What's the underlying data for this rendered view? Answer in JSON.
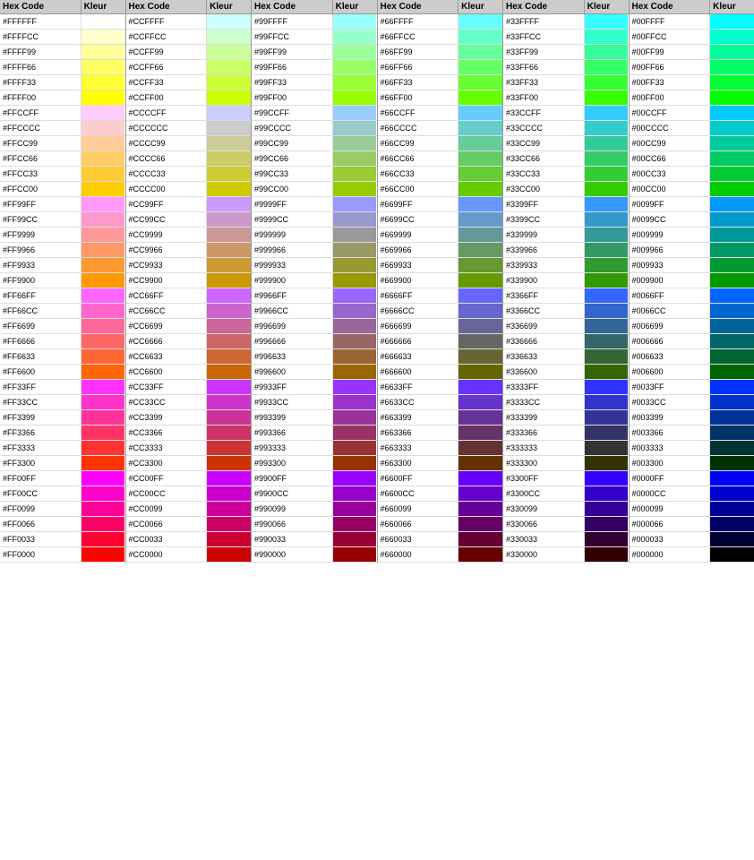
{
  "columns": [
    {
      "header": {
        "hex": "Hex Code",
        "kleur": "Kleur"
      },
      "colors": [
        {
          "hex": "#FFFFFF",
          "color": "#FFFFFF"
        },
        {
          "hex": "#FFFFCC",
          "color": "#FFFFCC"
        },
        {
          "hex": "#FFFF99",
          "color": "#FFFF99"
        },
        {
          "hex": "#FFFF66",
          "color": "#FFFF66"
        },
        {
          "hex": "#FFFF33",
          "color": "#FFFF33"
        },
        {
          "hex": "#FFFF00",
          "color": "#FFFF00"
        },
        {
          "hex": "#FFCCFF",
          "color": "#FFCCFF"
        },
        {
          "hex": "#FFCCCC",
          "color": "#FFCCCC"
        },
        {
          "hex": "#FFCC99",
          "color": "#FFCC99"
        },
        {
          "hex": "#FFCC66",
          "color": "#FFCC66"
        },
        {
          "hex": "#FFCC33",
          "color": "#FFCC33"
        },
        {
          "hex": "#FFCC00",
          "color": "#FFCC00"
        },
        {
          "hex": "#FF99FF",
          "color": "#FF99FF"
        },
        {
          "hex": "#FF99CC",
          "color": "#FF99CC"
        },
        {
          "hex": "#FF9999",
          "color": "#FF9999"
        },
        {
          "hex": "#FF9966",
          "color": "#FF9966"
        },
        {
          "hex": "#FF9933",
          "color": "#FF9933"
        },
        {
          "hex": "#FF9900",
          "color": "#FF9900"
        },
        {
          "hex": "#FF66FF",
          "color": "#FF66FF"
        },
        {
          "hex": "#FF66CC",
          "color": "#FF66CC"
        },
        {
          "hex": "#FF6699",
          "color": "#FF6699"
        },
        {
          "hex": "#FF6666",
          "color": "#FF6666"
        },
        {
          "hex": "#FF6633",
          "color": "#FF6633"
        },
        {
          "hex": "#FF6600",
          "color": "#FF6600"
        },
        {
          "hex": "#FF33FF",
          "color": "#FF33FF"
        },
        {
          "hex": "#FF33CC",
          "color": "#FF33CC"
        },
        {
          "hex": "#FF3399",
          "color": "#FF3399"
        },
        {
          "hex": "#FF3366",
          "color": "#FF3366"
        },
        {
          "hex": "#FF3333",
          "color": "#FF3333"
        },
        {
          "hex": "#FF3300",
          "color": "#FF3300"
        },
        {
          "hex": "#FF00FF",
          "color": "#FF00FF"
        },
        {
          "hex": "#FF00CC",
          "color": "#FF00CC"
        },
        {
          "hex": "#FF0099",
          "color": "#FF0099"
        },
        {
          "hex": "#FF0066",
          "color": "#FF0066"
        },
        {
          "hex": "#FF0033",
          "color": "#FF0033"
        },
        {
          "hex": "#FF0000",
          "color": "#FF0000"
        }
      ]
    },
    {
      "header": {
        "hex": "Hex Code",
        "kleur": "Kleur"
      },
      "colors": [
        {
          "hex": "#CCFFFF",
          "color": "#CCFFFF"
        },
        {
          "hex": "#CCFFCC",
          "color": "#CCFFCC"
        },
        {
          "hex": "#CCFF99",
          "color": "#CCFF99"
        },
        {
          "hex": "#CCFF66",
          "color": "#CCFF66"
        },
        {
          "hex": "#CCFF33",
          "color": "#CCFF33"
        },
        {
          "hex": "#CCFF00",
          "color": "#CCFF00"
        },
        {
          "hex": "#CCCCFF",
          "color": "#CCCCFF"
        },
        {
          "hex": "#CCCCCC",
          "color": "#CCCCCC"
        },
        {
          "hex": "#CCCC99",
          "color": "#CCCC99"
        },
        {
          "hex": "#CCCC66",
          "color": "#CCCC66"
        },
        {
          "hex": "#CCCC33",
          "color": "#CCCC33"
        },
        {
          "hex": "#CCCC00",
          "color": "#CCCC00"
        },
        {
          "hex": "#CC99FF",
          "color": "#CC99FF"
        },
        {
          "hex": "#CC99CC",
          "color": "#CC99CC"
        },
        {
          "hex": "#CC9999",
          "color": "#CC9999"
        },
        {
          "hex": "#CC9966",
          "color": "#CC9966"
        },
        {
          "hex": "#CC9933",
          "color": "#CC9933"
        },
        {
          "hex": "#CC9900",
          "color": "#CC9900"
        },
        {
          "hex": "#CC66FF",
          "color": "#CC66FF"
        },
        {
          "hex": "#CC66CC",
          "color": "#CC66CC"
        },
        {
          "hex": "#CC6699",
          "color": "#CC6699"
        },
        {
          "hex": "#CC6666",
          "color": "#CC6666"
        },
        {
          "hex": "#CC6633",
          "color": "#CC6633"
        },
        {
          "hex": "#CC6600",
          "color": "#CC6600"
        },
        {
          "hex": "#CC33FF",
          "color": "#CC33FF"
        },
        {
          "hex": "#CC33CC",
          "color": "#CC33CC"
        },
        {
          "hex": "#CC3399",
          "color": "#CC3399"
        },
        {
          "hex": "#CC3366",
          "color": "#CC3366"
        },
        {
          "hex": "#CC3333",
          "color": "#CC3333"
        },
        {
          "hex": "#CC3300",
          "color": "#CC3300"
        },
        {
          "hex": "#CC00FF",
          "color": "#CC00FF"
        },
        {
          "hex": "#CC00CC",
          "color": "#CC00CC"
        },
        {
          "hex": "#CC0099",
          "color": "#CC0099"
        },
        {
          "hex": "#CC0066",
          "color": "#CC0066"
        },
        {
          "hex": "#CC0033",
          "color": "#CC0033"
        },
        {
          "hex": "#CC0000",
          "color": "#CC0000"
        }
      ]
    },
    {
      "header": {
        "hex": "Hex Code",
        "kleur": "Kleur"
      },
      "colors": [
        {
          "hex": "#99FFFF",
          "color": "#99FFFF"
        },
        {
          "hex": "#99FFCC",
          "color": "#99FFCC"
        },
        {
          "hex": "#99FF99",
          "color": "#99FF99"
        },
        {
          "hex": "#99FF66",
          "color": "#99FF66"
        },
        {
          "hex": "#99FF33",
          "color": "#99FF33"
        },
        {
          "hex": "#99FF00",
          "color": "#99FF00"
        },
        {
          "hex": "#99CCFF",
          "color": "#99CCFF"
        },
        {
          "hex": "#99CCCC",
          "color": "#99CCCC"
        },
        {
          "hex": "#99CC99",
          "color": "#99CC99"
        },
        {
          "hex": "#99CC66",
          "color": "#99CC66"
        },
        {
          "hex": "#99CC33",
          "color": "#99CC33"
        },
        {
          "hex": "#99CC00",
          "color": "#99CC00"
        },
        {
          "hex": "#9999FF",
          "color": "#9999FF"
        },
        {
          "hex": "#9999CC",
          "color": "#9999CC"
        },
        {
          "hex": "#999999",
          "color": "#999999"
        },
        {
          "hex": "#999966",
          "color": "#999966"
        },
        {
          "hex": "#999933",
          "color": "#999933"
        },
        {
          "hex": "#999900",
          "color": "#999900"
        },
        {
          "hex": "#9966FF",
          "color": "#9966FF"
        },
        {
          "hex": "#9966CC",
          "color": "#9966CC"
        },
        {
          "hex": "#996699",
          "color": "#996699"
        },
        {
          "hex": "#996666",
          "color": "#996666"
        },
        {
          "hex": "#996633",
          "color": "#996633"
        },
        {
          "hex": "#996600",
          "color": "#996600"
        },
        {
          "hex": "#9933FF",
          "color": "#9933FF"
        },
        {
          "hex": "#9933CC",
          "color": "#9933CC"
        },
        {
          "hex": "#993399",
          "color": "#993399"
        },
        {
          "hex": "#993366",
          "color": "#993366"
        },
        {
          "hex": "#993333",
          "color": "#993333"
        },
        {
          "hex": "#993300",
          "color": "#993300"
        },
        {
          "hex": "#9900FF",
          "color": "#9900FF"
        },
        {
          "hex": "#9900CC",
          "color": "#9900CC"
        },
        {
          "hex": "#990099",
          "color": "#990099"
        },
        {
          "hex": "#990066",
          "color": "#990066"
        },
        {
          "hex": "#990033",
          "color": "#990033"
        },
        {
          "hex": "#990000",
          "color": "#990000"
        }
      ]
    },
    {
      "header": {
        "hex": "Hex Code",
        "kleur": "Kleur"
      },
      "colors": [
        {
          "hex": "#66FFFF",
          "color": "#66FFFF"
        },
        {
          "hex": "#66FFCC",
          "color": "#66FFCC"
        },
        {
          "hex": "#66FF99",
          "color": "#66FF99"
        },
        {
          "hex": "#66FF66",
          "color": "#66FF66"
        },
        {
          "hex": "#66FF33",
          "color": "#66FF33"
        },
        {
          "hex": "#66FF00",
          "color": "#66FF00"
        },
        {
          "hex": "#66CCFF",
          "color": "#66CCFF"
        },
        {
          "hex": "#66CCCC",
          "color": "#66CCCC"
        },
        {
          "hex": "#66CC99",
          "color": "#66CC99"
        },
        {
          "hex": "#66CC66",
          "color": "#66CC66"
        },
        {
          "hex": "#66CC33",
          "color": "#66CC33"
        },
        {
          "hex": "#66CC00",
          "color": "#66CC00"
        },
        {
          "hex": "#6699FF",
          "color": "#6699FF"
        },
        {
          "hex": "#6699CC",
          "color": "#6699CC"
        },
        {
          "hex": "#669999",
          "color": "#669999"
        },
        {
          "hex": "#669966",
          "color": "#669966"
        },
        {
          "hex": "#669933",
          "color": "#669933"
        },
        {
          "hex": "#669900",
          "color": "#669900"
        },
        {
          "hex": "#6666FF",
          "color": "#6666FF"
        },
        {
          "hex": "#6666CC",
          "color": "#6666CC"
        },
        {
          "hex": "#666699",
          "color": "#666699"
        },
        {
          "hex": "#666666",
          "color": "#666666"
        },
        {
          "hex": "#666633",
          "color": "#666633"
        },
        {
          "hex": "#666600",
          "color": "#666600"
        },
        {
          "hex": "#6633FF",
          "color": "#6633FF"
        },
        {
          "hex": "#6633CC",
          "color": "#6633CC"
        },
        {
          "hex": "#663399",
          "color": "#663399"
        },
        {
          "hex": "#663366",
          "color": "#663366"
        },
        {
          "hex": "#663333",
          "color": "#663333"
        },
        {
          "hex": "#663300",
          "color": "#663300"
        },
        {
          "hex": "#6600FF",
          "color": "#6600FF"
        },
        {
          "hex": "#6600CC",
          "color": "#6600CC"
        },
        {
          "hex": "#660099",
          "color": "#660099"
        },
        {
          "hex": "#660066",
          "color": "#660066"
        },
        {
          "hex": "#660033",
          "color": "#660033"
        },
        {
          "hex": "#660000",
          "color": "#660000"
        }
      ]
    },
    {
      "header": {
        "hex": "Hex Code",
        "kleur": "Kleur"
      },
      "colors": [
        {
          "hex": "#33FFFF",
          "color": "#33FFFF"
        },
        {
          "hex": "#33FFCC",
          "color": "#33FFCC"
        },
        {
          "hex": "#33FF99",
          "color": "#33FF99"
        },
        {
          "hex": "#33FF66",
          "color": "#33FF66"
        },
        {
          "hex": "#33FF33",
          "color": "#33FF33"
        },
        {
          "hex": "#33FF00",
          "color": "#33FF00"
        },
        {
          "hex": "#33CCFF",
          "color": "#33CCFF"
        },
        {
          "hex": "#33CCCC",
          "color": "#33CCCC"
        },
        {
          "hex": "#33CC99",
          "color": "#33CC99"
        },
        {
          "hex": "#33CC66",
          "color": "#33CC66"
        },
        {
          "hex": "#33CC33",
          "color": "#33CC33"
        },
        {
          "hex": "#33CC00",
          "color": "#33CC00"
        },
        {
          "hex": "#3399FF",
          "color": "#3399FF"
        },
        {
          "hex": "#3399CC",
          "color": "#3399CC"
        },
        {
          "hex": "#339999",
          "color": "#339999"
        },
        {
          "hex": "#339966",
          "color": "#339966"
        },
        {
          "hex": "#339933",
          "color": "#339933"
        },
        {
          "hex": "#339900",
          "color": "#339900"
        },
        {
          "hex": "#3366FF",
          "color": "#3366FF"
        },
        {
          "hex": "#3366CC",
          "color": "#3366CC"
        },
        {
          "hex": "#336699",
          "color": "#336699"
        },
        {
          "hex": "#336666",
          "color": "#336666"
        },
        {
          "hex": "#336633",
          "color": "#336633"
        },
        {
          "hex": "#336600",
          "color": "#336600"
        },
        {
          "hex": "#3333FF",
          "color": "#3333FF"
        },
        {
          "hex": "#3333CC",
          "color": "#3333CC"
        },
        {
          "hex": "#333399",
          "color": "#333399"
        },
        {
          "hex": "#333366",
          "color": "#333366"
        },
        {
          "hex": "#333333",
          "color": "#333333"
        },
        {
          "hex": "#333300",
          "color": "#333300"
        },
        {
          "hex": "#3300FF",
          "color": "#3300FF"
        },
        {
          "hex": "#3300CC",
          "color": "#3300CC"
        },
        {
          "hex": "#330099",
          "color": "#330099"
        },
        {
          "hex": "#330066",
          "color": "#330066"
        },
        {
          "hex": "#330033",
          "color": "#330033"
        },
        {
          "hex": "#330000",
          "color": "#330000"
        }
      ]
    },
    {
      "header": {
        "hex": "Hex Code",
        "kleur": "Kleur"
      },
      "colors": [
        {
          "hex": "#00FFFF",
          "color": "#00FFFF"
        },
        {
          "hex": "#00FFCC",
          "color": "#00FFCC"
        },
        {
          "hex": "#00FF99",
          "color": "#00FF99"
        },
        {
          "hex": "#00FF66",
          "color": "#00FF66"
        },
        {
          "hex": "#00FF33",
          "color": "#00FF33"
        },
        {
          "hex": "#00FF00",
          "color": "#00FF00"
        },
        {
          "hex": "#00CCFF",
          "color": "#00CCFF"
        },
        {
          "hex": "#00CCCC",
          "color": "#00CCCC"
        },
        {
          "hex": "#00CC99",
          "color": "#00CC99"
        },
        {
          "hex": "#00CC66",
          "color": "#00CC66"
        },
        {
          "hex": "#00CC33",
          "color": "#00CC33"
        },
        {
          "hex": "#00CC00",
          "color": "#00CC00"
        },
        {
          "hex": "#0099FF",
          "color": "#0099FF"
        },
        {
          "hex": "#0099CC",
          "color": "#0099CC"
        },
        {
          "hex": "#009999",
          "color": "#009999"
        },
        {
          "hex": "#009966",
          "color": "#009966"
        },
        {
          "hex": "#009933",
          "color": "#009933"
        },
        {
          "hex": "#009900",
          "color": "#009900"
        },
        {
          "hex": "#0066FF",
          "color": "#0066FF"
        },
        {
          "hex": "#0066CC",
          "color": "#0066CC"
        },
        {
          "hex": "#006699",
          "color": "#006699"
        },
        {
          "hex": "#006666",
          "color": "#006666"
        },
        {
          "hex": "#006633",
          "color": "#006633"
        },
        {
          "hex": "#006600",
          "color": "#006600"
        },
        {
          "hex": "#0033FF",
          "color": "#0033FF"
        },
        {
          "hex": "#0033CC",
          "color": "#0033CC"
        },
        {
          "hex": "#003399",
          "color": "#003399"
        },
        {
          "hex": "#003366",
          "color": "#003366"
        },
        {
          "hex": "#003333",
          "color": "#003333"
        },
        {
          "hex": "#003300",
          "color": "#003300"
        },
        {
          "hex": "#0000FF",
          "color": "#0000FF"
        },
        {
          "hex": "#0000CC",
          "color": "#0000CC"
        },
        {
          "hex": "#000099",
          "color": "#000099"
        },
        {
          "hex": "#000066",
          "color": "#000066"
        },
        {
          "hex": "#000033",
          "color": "#000033"
        },
        {
          "hex": "#000000",
          "color": "#000000"
        }
      ]
    }
  ]
}
